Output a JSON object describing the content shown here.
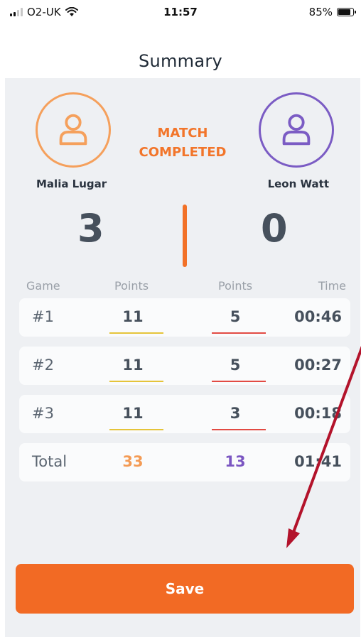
{
  "status_bar": {
    "carrier": "O2-UK",
    "time": "11:57",
    "battery_percent": "85%",
    "battery_level": 0.85,
    "signal_bars": 4,
    "signal_bars_active": 2,
    "wifi_icon": "wifi-icon"
  },
  "header": {
    "title": "Summary"
  },
  "match": {
    "status_line1": "MATCH",
    "status_line2": "COMPLETED",
    "player1": {
      "name": "Malia Lugar",
      "score": "3",
      "color": "#f5a05c",
      "icon": "user-icon"
    },
    "player2": {
      "name": "Leon Watt",
      "score": "0",
      "color": "#7b5cc4",
      "icon": "user-icon"
    }
  },
  "table": {
    "headers": {
      "game": "Game",
      "p1_points": "Points",
      "p2_points": "Points",
      "time": "Time"
    },
    "rows": [
      {
        "game": "#1",
        "p1": "11",
        "p2": "5",
        "time": "00:46"
      },
      {
        "game": "#2",
        "p1": "11",
        "p2": "5",
        "time": "00:27"
      },
      {
        "game": "#3",
        "p1": "11",
        "p2": "3",
        "time": "00:18"
      }
    ],
    "total": {
      "label": "Total",
      "p1": "33",
      "p2": "13",
      "time": "01:41"
    }
  },
  "actions": {
    "save_label": "Save"
  },
  "colors": {
    "accent": "#f26a24",
    "player1": "#f5a05c",
    "player2": "#7b5cc4",
    "annotation_arrow": "#b3132b"
  }
}
